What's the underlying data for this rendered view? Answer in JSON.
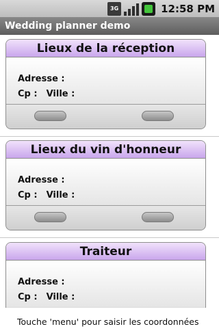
{
  "status_bar": {
    "network": "3G",
    "time": "12:58 PM"
  },
  "app": {
    "title": "Wedding planner demo"
  },
  "cards": [
    {
      "title": "Lieux de la réception",
      "address_label": "Adresse :",
      "cp_label": "Cp :",
      "city_label": "Ville :"
    },
    {
      "title": "Lieux du vin d'honneur",
      "address_label": "Adresse :",
      "cp_label": "Cp :",
      "city_label": "Ville :"
    },
    {
      "title": "Traiteur",
      "address_label": "Adresse :",
      "cp_label": "Cp :",
      "city_label": "Ville :"
    }
  ],
  "hint": "Touche 'menu' pour saisir les coordonnées",
  "colors": {
    "card_header_top": "#f1e2fb",
    "card_header_bottom": "#c9a6ec",
    "title_bar": "#5d5d5d",
    "battery": "#44c53c"
  }
}
